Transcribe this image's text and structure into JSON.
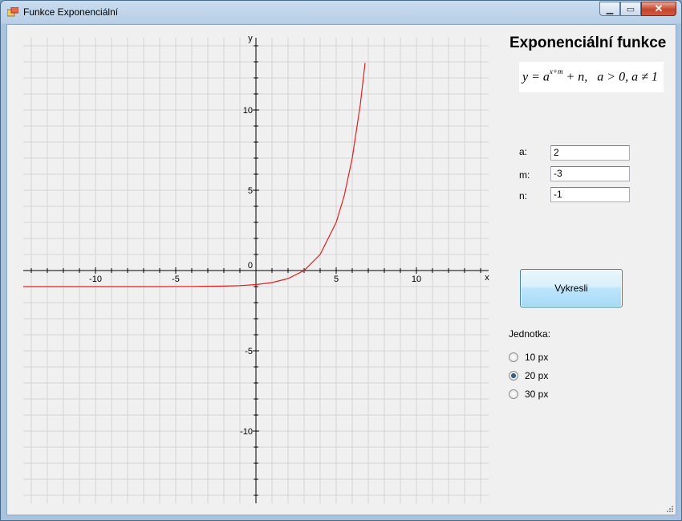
{
  "window": {
    "title": "Funkce Exponenciální"
  },
  "panel": {
    "heading": "Exponenciální funkce",
    "formula": {
      "lhs": "y = a",
      "exponent": "x+m",
      "rhs": " + n,",
      "condition": "a > 0, a ≠ 1"
    },
    "fields": [
      {
        "label": "a:",
        "value": "2"
      },
      {
        "label": "m:",
        "value": "-3"
      },
      {
        "label": "n:",
        "value": "-1"
      }
    ],
    "draw_button": "Vykresli",
    "unit_label": "Jednotka:",
    "units": [
      {
        "label": "10 px",
        "checked": false
      },
      {
        "label": "20 px",
        "checked": true
      },
      {
        "label": "30 px",
        "checked": false
      }
    ]
  },
  "chart_data": {
    "type": "line",
    "function": "y = 2^(x-3) - 1",
    "params": {
      "a": 2,
      "m": -3,
      "n": -1
    },
    "xlabel": "x",
    "ylabel": "y",
    "xlim": [
      -14.5,
      14.5
    ],
    "ylim": [
      -14.5,
      14.5
    ],
    "x_ticks": [
      -10,
      -5,
      0,
      5,
      10
    ],
    "y_ticks": [
      10,
      5,
      -5,
      -10
    ],
    "origin_label": "0",
    "grid": true,
    "series": [
      {
        "color": "#e02020",
        "x": [
          -14.5,
          -10,
          -6,
          -4,
          -2,
          -1,
          0,
          1,
          2,
          3,
          4,
          5,
          5.5,
          6,
          6.5,
          6.8
        ],
        "y": [
          -1,
          -0.999,
          -0.998,
          -0.992,
          -0.969,
          -0.938,
          -0.875,
          -0.75,
          -0.5,
          0,
          1,
          3,
          4.657,
          7,
          10.314,
          12.929
        ]
      }
    ],
    "colors": {
      "grid": "#d4d4d4",
      "axes": "#000000",
      "curve": "#e02020",
      "background": "#f0f0f0"
    }
  }
}
